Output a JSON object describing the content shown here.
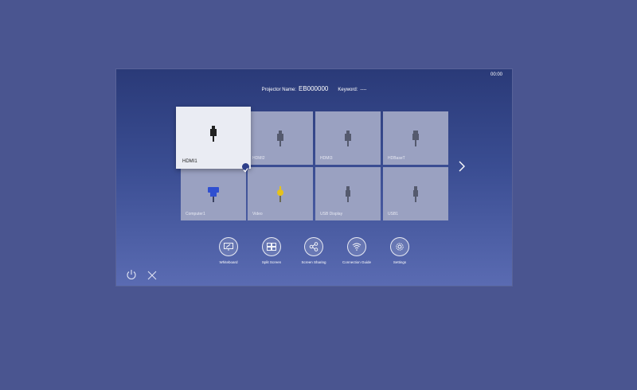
{
  "clock": "00:00",
  "header": {
    "projector_name_label": "Projector Name:",
    "projector_name": "EB000000",
    "keyword_label": "Keyword:",
    "keyword": "----"
  },
  "sources": [
    {
      "label": "HDMI1",
      "icon": "hdmi-plug-icon",
      "selected": true
    },
    {
      "label": "HDMI2",
      "icon": "hdmi-plug-icon"
    },
    {
      "label": "HDMI3",
      "icon": "hdmi-plug-icon"
    },
    {
      "label": "HDBaseT",
      "icon": "hdbaset-plug-icon"
    },
    {
      "label": "Computer1",
      "icon": "vga-plug-icon",
      "checked": true
    },
    {
      "label": "Video",
      "icon": "rca-plug-icon"
    },
    {
      "label": "USB Display",
      "icon": "usb-plug-icon"
    },
    {
      "label": "USB1",
      "icon": "usb-plug-icon"
    }
  ],
  "tools": [
    {
      "label": "Whiteboard",
      "icon": "whiteboard-icon"
    },
    {
      "label": "Split Screen",
      "icon": "split-screen-icon"
    },
    {
      "label": "Screen Sharing",
      "icon": "screen-sharing-icon"
    },
    {
      "label": "Connection Guide",
      "icon": "connection-guide-icon"
    },
    {
      "label": "Settings",
      "icon": "settings-icon"
    }
  ],
  "colors": {
    "background": "#4a5590",
    "tile": "#9aa1c1",
    "tile_selected": "#eaecf3",
    "vga_accent": "#2f4fd0",
    "rca_accent": "#e6c21a"
  }
}
